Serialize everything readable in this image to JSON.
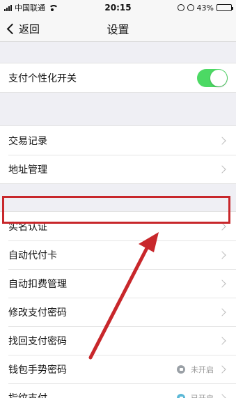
{
  "status": {
    "carrier": "中国联通",
    "time": "20:15",
    "battery_pct": "43%",
    "battery_level": 0.43
  },
  "nav": {
    "back_label": "返回",
    "title": "设置"
  },
  "rows": {
    "personalization": {
      "label": "支付个性化开关",
      "toggle_on": true
    },
    "transactions": {
      "label": "交易记录"
    },
    "address": {
      "label": "地址管理"
    },
    "realname": {
      "label": "实名认证"
    },
    "auto_card": {
      "label": "自动代付卡"
    },
    "auto_deduct": {
      "label": "自动扣费管理"
    },
    "change_pwd": {
      "label": "修改支付密码"
    },
    "recover_pwd": {
      "label": "找回支付密码"
    },
    "gesture_pwd": {
      "label": "钱包手势密码",
      "status": "未开启"
    },
    "fingerprint": {
      "label": "指纹支付",
      "status": "已开启"
    }
  },
  "annotation": {
    "highlight_color": "#c8272b",
    "arrow_color": "#c8272b"
  },
  "colors": {
    "toggle_on": "#4cd964",
    "background": "#efeff4"
  }
}
